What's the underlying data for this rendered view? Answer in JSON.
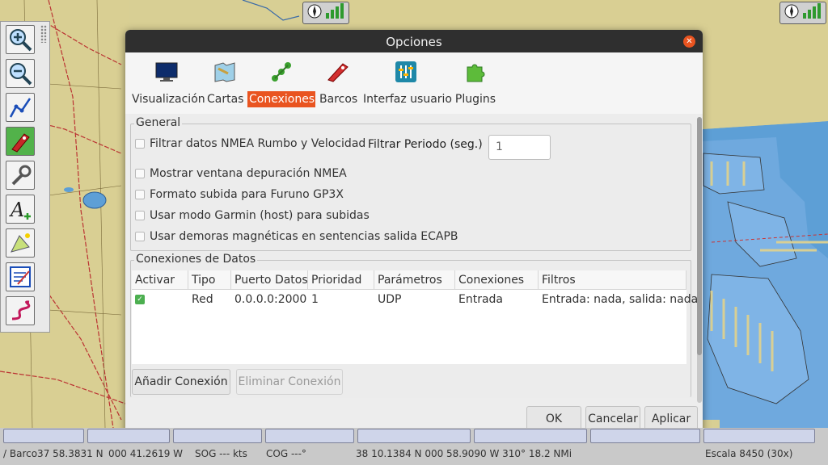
{
  "dialog": {
    "title": "Opciones",
    "tabs": [
      {
        "label": "Visualización",
        "icon": "monitor-icon"
      },
      {
        "label": "Cartas",
        "icon": "charts-icon"
      },
      {
        "label": "Conexiones",
        "icon": "connections-icon",
        "active": true
      },
      {
        "label": "Barcos",
        "icon": "ship-icon"
      },
      {
        "label": "Interfaz usuario",
        "icon": "sliders-icon"
      },
      {
        "label": "Plugins",
        "icon": "puzzle-icon"
      }
    ],
    "general": {
      "legend": "General",
      "options": [
        {
          "label": "Filtrar datos NMEA Rumbo y Velocidad",
          "checked": false
        },
        {
          "label": "Mostrar ventana depuración NMEA",
          "checked": false
        },
        {
          "label": "Formato subida para Furuno GP3X",
          "checked": false
        },
        {
          "label": "Usar modo Garmin (host) para subidas",
          "checked": false
        },
        {
          "label": "Usar demoras magnéticas en sentencias salida ECAPB",
          "checked": false
        }
      ],
      "filter_label": "Filtrar Periodo (seg.)",
      "filter_value": "1"
    },
    "connections": {
      "legend": "Conexiones de Datos",
      "columns": [
        "Activar",
        "Tipo",
        "Puerto Datos",
        "Prioridad",
        "Parámetros",
        "Conexiones",
        "Filtros"
      ],
      "rows": [
        {
          "enabled": true,
          "tipo": "Red",
          "puerto": "0.0.0.0:2000",
          "prioridad": "1",
          "parametros": "UDP",
          "conexiones": "Entrada",
          "filtros": "Entrada: nada, salida: nada"
        }
      ],
      "add_label": "Añadir Conexión",
      "remove_label": "Eliminar Conexión"
    },
    "buttons": {
      "ok": "OK",
      "cancel": "Cancelar",
      "apply": "Aplicar"
    }
  },
  "statusbar": {
    "left_boat": "/ Barco37 58.3831 N",
    "left_lon": "000 41.2619 W",
    "sog": "SOG --- kts",
    "cog": "COG ---°",
    "cursor": "38 10.1384 N  000 58.9090 W  310°  18.2 NMi",
    "scale": "Escala 8450 (30x)"
  },
  "colors": {
    "accent": "#e95420",
    "titlebar": "#2f2f2f",
    "sea": "#5d9fd6",
    "land": "#d8cf94"
  }
}
